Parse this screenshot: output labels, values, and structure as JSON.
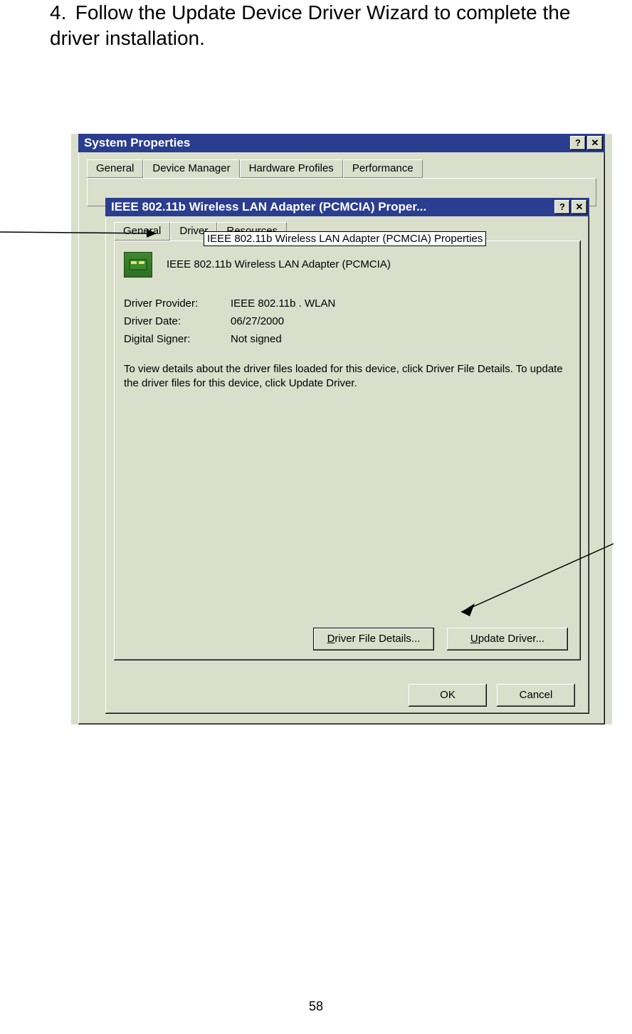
{
  "instruction": {
    "number": "4.",
    "text": "Follow the Update Device Driver Wizard to complete the driver installation."
  },
  "outer_window": {
    "title": "System Properties",
    "help_btn": "?",
    "close_btn": "✕",
    "tabs": [
      "General",
      "Device Manager",
      "Hardware Profiles",
      "Performance"
    ]
  },
  "inner_window": {
    "title": "IEEE 802.11b Wireless LAN Adapter (PCMCIA) Proper...",
    "help_btn": "?",
    "close_btn": "✕",
    "tooltip": "IEEE 802.11b Wireless LAN Adapter (PCMCIA) Properties",
    "tabs": [
      "General",
      "Driver",
      "Resources"
    ],
    "device_name": "IEEE 802.11b Wireless LAN Adapter (PCMCIA)",
    "device_icon_hint": "network-card-icon",
    "fields": {
      "provider_label": "Driver Provider:",
      "provider_value": "IEEE 802.11b . WLAN",
      "date_label": "Driver Date:",
      "date_value": "06/27/2000",
      "signer_label": "Digital Signer:",
      "signer_value": "Not signed"
    },
    "help_text": "To view details about the driver files loaded for this device, click Driver File Details.  To update the driver files for this device, click Update Driver.",
    "buttons": {
      "details": "Driver File Details...",
      "update": "Update Driver..."
    }
  },
  "bottom_buttons": {
    "ok": "OK",
    "cancel": "Cancel"
  },
  "page_number": "58"
}
